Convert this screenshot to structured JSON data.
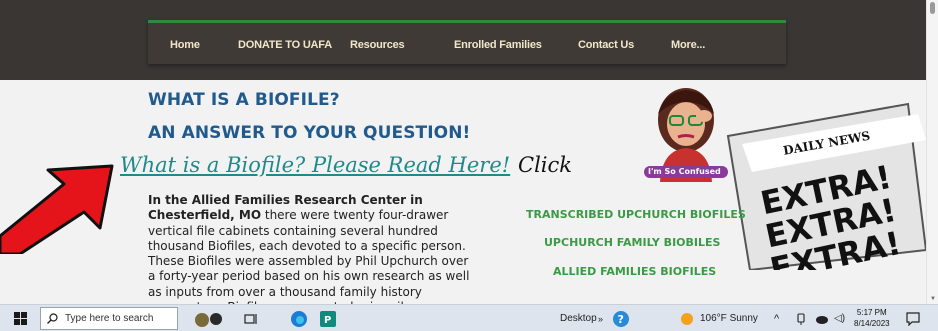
{
  "nav": {
    "items": [
      "Home",
      "DONATE TO UAFA",
      "Resources",
      "Enrolled Families",
      "Contact Us",
      "More..."
    ]
  },
  "heading": {
    "line1": "WHAT IS A BIOFILE?",
    "line2": "AN ANSWER TO YOUR QUESTION!"
  },
  "link": {
    "text": "What is a Biofile? Please Read Here!",
    "click": "Click"
  },
  "bitmoji": {
    "caption": "I'm So Confused"
  },
  "newspaper": {
    "masthead": "DAILY NEWS",
    "headline": "EXTRA!"
  },
  "paragraph": {
    "bold_lead": "In the Allied Families Research Center in Chesterfield, MO",
    "body": " there were twenty four-drawer vertical file cabinets containing several hundred thousand Biofiles, each devoted to a specific person. These Biofiles were assembled by Phil Upchurch over a forty-year period based on his own research as well as inputs from over a thousand family history cooperators. Biofiles were created primarily"
  },
  "side_links": [
    "TRANSCRIBED UPCHURCH BIOFILES",
    "UPCHURCH FAMILY BIOBILES",
    "ALLIED FAMILIES BIOFILES"
  ],
  "taskbar": {
    "search_placeholder": "Type here to search",
    "desktop": "Desktop",
    "weather": "106°F  Sunny",
    "time": "5:17 PM",
    "date": "8/14/2023"
  },
  "colors": {
    "heading": "#215a8c",
    "link": "#1f8a8a",
    "side_link": "#3b9a45",
    "nav_accent": "#2e8a3c",
    "arrow": "#e5141b"
  }
}
